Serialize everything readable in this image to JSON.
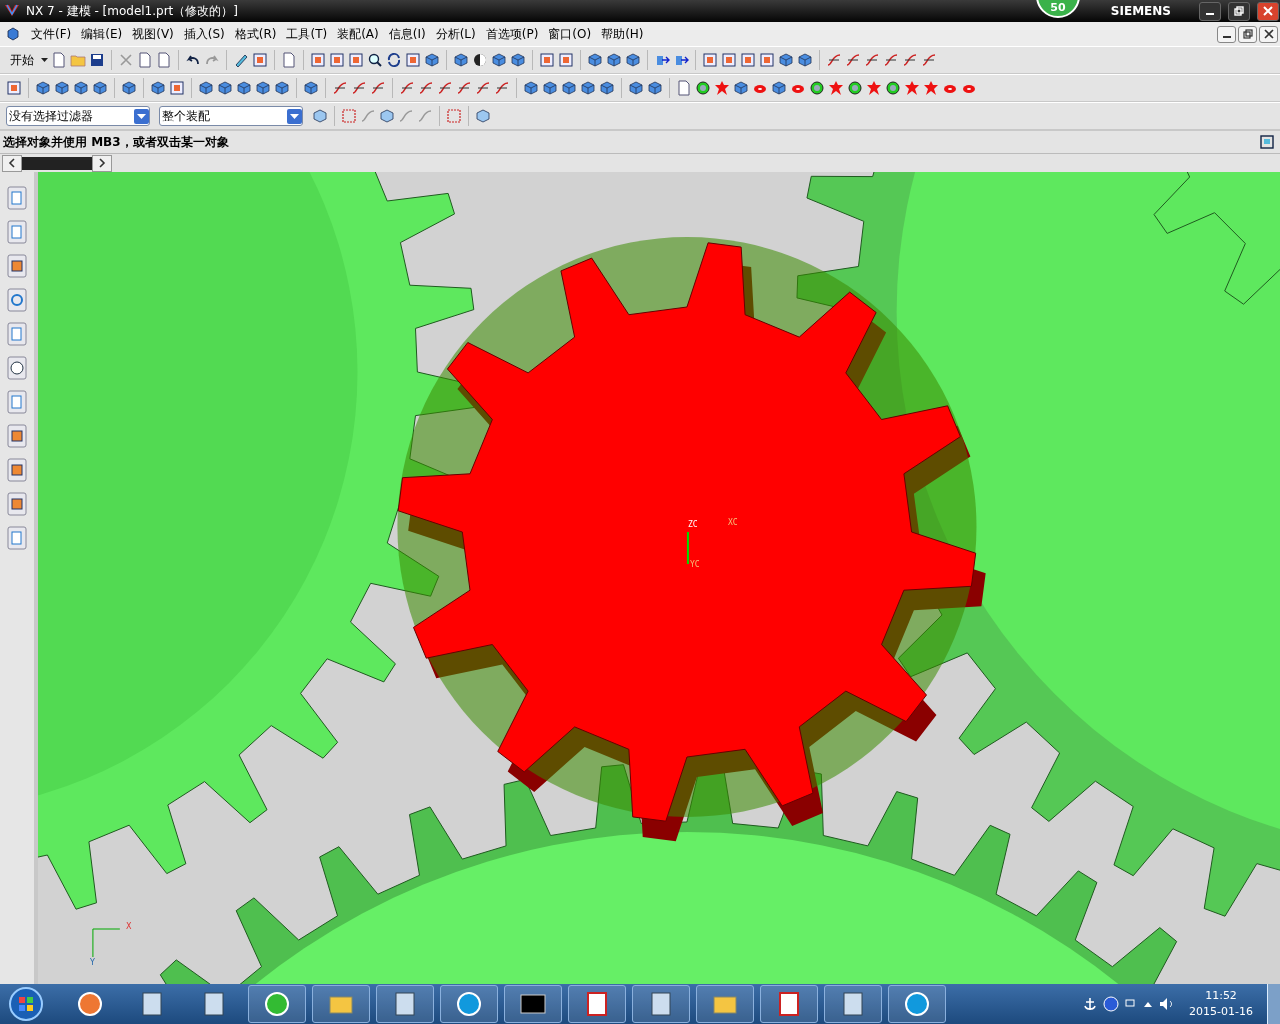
{
  "window": {
    "title": "NX 7 - 建模 - [model1.prt（修改的）]",
    "badge": "50",
    "brand": "SIEMENS"
  },
  "menu": [
    "文件(F)",
    "编辑(E)",
    "视图(V)",
    "插入(S)",
    "格式(R)",
    "工具(T)",
    "装配(A)",
    "信息(I)",
    "分析(L)",
    "首选项(P)",
    "窗口(O)",
    "帮助(H)"
  ],
  "toolbar": {
    "start_label": "开始"
  },
  "filters": [
    {
      "value": "没有选择过滤器"
    },
    {
      "value": "整个装配"
    }
  ],
  "prompt": "选择对象并使用 MB3，或者双击某一对象",
  "viewport": {
    "triad": [
      "ZC",
      "XC",
      "YC"
    ],
    "view_triad": [
      "X",
      "Y"
    ]
  },
  "taskbar": {
    "time": "11:52",
    "date": "2015-01-16"
  }
}
